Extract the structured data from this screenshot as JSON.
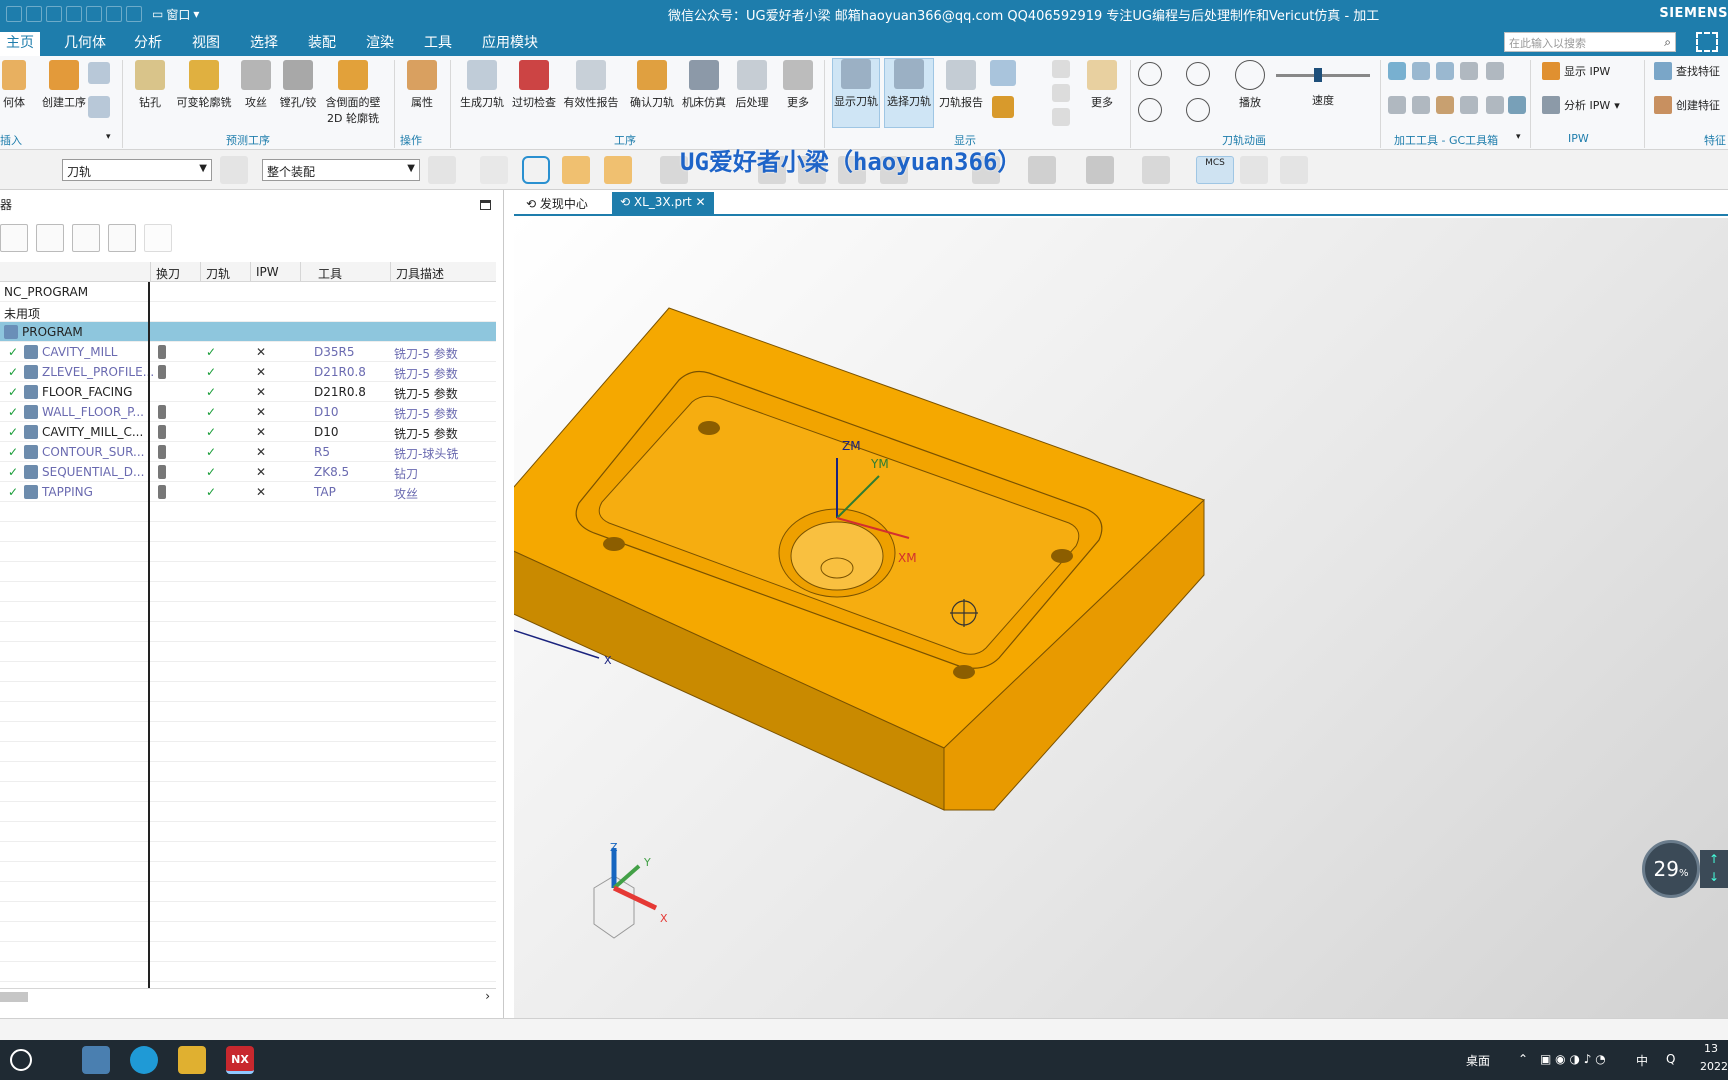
{
  "app": {
    "title": "微信公众号：UG爱好者小梁  邮箱haoyuan366@qq.com   QQ406592919  专注UG编程与后处理制作和Vericut仿真 - 加工",
    "brand": "SIEMENS",
    "window_menu": "窗口"
  },
  "menu": {
    "tabs": [
      "主页",
      "几何体",
      "分析",
      "视图",
      "选择",
      "装配",
      "渲染",
      "工具",
      "应用模块"
    ],
    "search_placeholder": "在此输入以搜索"
  },
  "ribbon": {
    "insert_group": {
      "buttons": [
        "何体",
        "创建工序"
      ],
      "label": "插入"
    },
    "predict_group": {
      "buttons": [
        "钻孔",
        "可变轮廓铣",
        "攻丝",
        "镗孔/铰",
        "含倒面的壁",
        "2D 轮廓铣"
      ],
      "label": "预测工序"
    },
    "operate_group": {
      "buttons": [
        "属性"
      ],
      "label": "操作"
    },
    "process_group": {
      "buttons": [
        "生成刀轨",
        "过切检查",
        "有效性报告",
        "确认刀轨",
        "机床仿真",
        "后处理",
        "更多"
      ],
      "label": "工序"
    },
    "display_group": {
      "buttons": [
        "显示刀轨",
        "选择刀轨",
        "刀轨报告",
        "更多"
      ],
      "label": "显示"
    },
    "anim_group": {
      "buttons": [
        "播放",
        "速度"
      ],
      "label": "刀轨动画"
    },
    "tools_group": {
      "label": "加工工具 - GC工具箱"
    },
    "ipw_group": {
      "buttons": [
        "显示 IPW",
        "分析 IPW"
      ],
      "label": "IPW"
    },
    "feature_group": {
      "buttons": [
        "查找特征",
        "创建特征"
      ],
      "label": "特征"
    }
  },
  "toolbar2": {
    "filter_type": "刀轨",
    "scope": "整个装配",
    "watermark": "UG爱好者小梁（haoyuan366）",
    "mcs_label": "MCS"
  },
  "navigator": {
    "header": "器",
    "columns": [
      "换刀",
      "刀轨",
      "IPW",
      "工具",
      "刀具描述"
    ],
    "rows": [
      {
        "name": "NC_PROGRAM",
        "tool": "",
        "desc": "",
        "style": "root"
      },
      {
        "name": "未用项",
        "tool": "",
        "desc": "",
        "style": "root"
      },
      {
        "name": "PROGRAM",
        "tool": "",
        "desc": "",
        "style": "selected"
      },
      {
        "name": "CAVITY_MILL",
        "tool": "D35R5",
        "desc": "铣刀-5 参数",
        "style": "grey"
      },
      {
        "name": "ZLEVEL_PROFILE...",
        "tool": "D21R0.8",
        "desc": "铣刀-5 参数",
        "style": "grey"
      },
      {
        "name": "FLOOR_FACING",
        "tool": "D21R0.8",
        "desc": "铣刀-5 参数",
        "style": "dark"
      },
      {
        "name": "WALL_FLOOR_P...",
        "tool": "D10",
        "desc": "铣刀-5 参数",
        "style": "grey"
      },
      {
        "name": "CAVITY_MILL_C...",
        "tool": "D10",
        "desc": "铣刀-5 参数",
        "style": "dark"
      },
      {
        "name": "CONTOUR_SUR...",
        "tool": "R5",
        "desc": "铣刀-球头铣",
        "style": "grey"
      },
      {
        "name": "SEQUENTIAL_D...",
        "tool": "ZK8.5",
        "desc": "钻刀",
        "style": "grey"
      },
      {
        "name": "TAPPING",
        "tool": "TAP",
        "desc": "攻丝",
        "style": "grey"
      }
    ]
  },
  "doc_tabs": [
    "发现中心",
    "XL_3X.prt"
  ],
  "viewport": {
    "labels": {
      "zm": "ZM",
      "ym": "YM",
      "xm": "XM",
      "z": "Z",
      "y": "Y",
      "x": "X"
    },
    "zoom_percent": "29",
    "zoom_unit": "%",
    "colors": {
      "part": "#f5a800",
      "part_dark": "#c78400",
      "part_side": "#e89a00"
    }
  },
  "taskbar": {
    "tray_desktop": "桌面",
    "ime": "中",
    "time": "13",
    "date": "2022"
  }
}
